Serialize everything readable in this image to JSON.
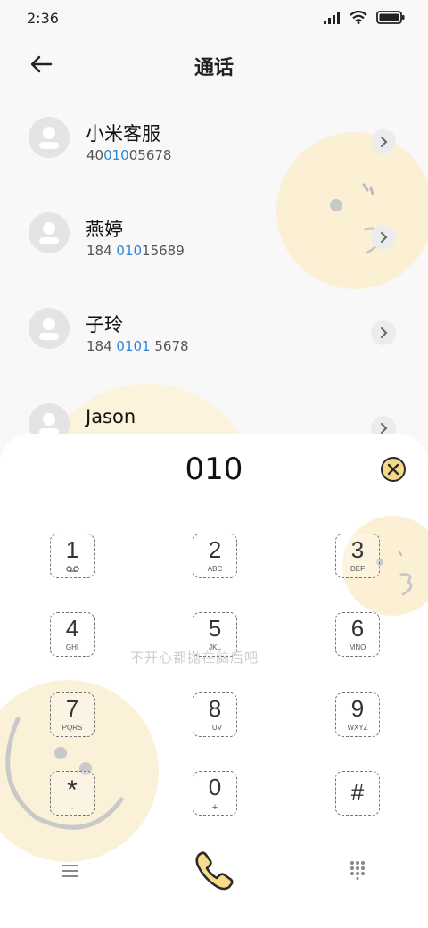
{
  "status_bar": {
    "time": "2:36"
  },
  "header": {
    "title": "通话"
  },
  "contacts": [
    {
      "name": "小米客服",
      "num_pre": "40",
      "num_hl": "010",
      "num_post": "05678"
    },
    {
      "name": "燕婷",
      "num_pre": "184 ",
      "num_hl": "010",
      "num_post": "15689"
    },
    {
      "name": "子玲",
      "num_pre": "184 ",
      "num_hl": "0101",
      "num_post": " 5678"
    },
    {
      "name": "Jason",
      "num_pre": "",
      "num_hl": "",
      "num_post": ""
    }
  ],
  "dialpad": {
    "input": "010",
    "keys": [
      {
        "digit": "1",
        "letters": ""
      },
      {
        "digit": "2",
        "letters": "ABC"
      },
      {
        "digit": "3",
        "letters": "DEF"
      },
      {
        "digit": "4",
        "letters": "GHI"
      },
      {
        "digit": "5",
        "letters": "JKL"
      },
      {
        "digit": "6",
        "letters": "MNO"
      },
      {
        "digit": "7",
        "letters": "PQRS"
      },
      {
        "digit": "8",
        "letters": "TUV"
      },
      {
        "digit": "9",
        "letters": "WXYZ"
      },
      {
        "digit": "*",
        "letters": ","
      },
      {
        "digit": "0",
        "letters": "+"
      },
      {
        "digit": "#",
        "letters": ""
      }
    ],
    "watermark": "不开心都抛在脑后吧"
  },
  "colors": {
    "accent_blue": "#2f86d6",
    "call_yellow": "#f8dc8a",
    "deco_cream": "#fbf0d4"
  },
  "icons": [
    "voicemail-icon",
    "back-arrow-icon",
    "clear-icon",
    "menu-icon",
    "phone-icon",
    "keypad-icon"
  ]
}
